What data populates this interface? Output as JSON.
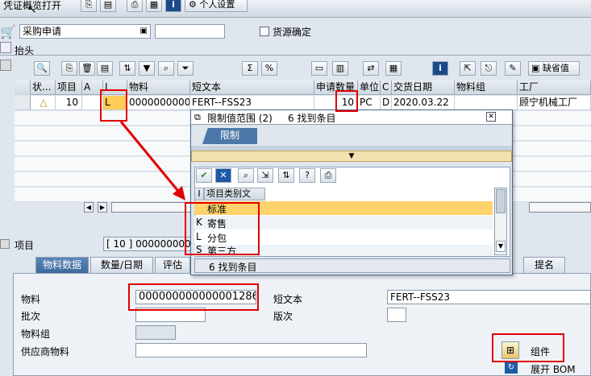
{
  "toolbar": {
    "doc_overview": "凭证概览打开",
    "personal_settings": "个人设置"
  },
  "header": {
    "doc_type": "采购申请",
    "source_assign_label": "货源确定",
    "section_label": "抬头"
  },
  "item_toolbar": {
    "default_values": "缺省值"
  },
  "grid": {
    "headers": [
      "状...",
      "项目",
      "A",
      "I",
      "物料",
      "短文本",
      "申请数量",
      "单位",
      "C",
      "交货日期",
      "物料组",
      "工厂"
    ],
    "row": {
      "status": "△",
      "item": "10",
      "a": "",
      "i": "L",
      "material": "000000000000",
      "short_text": "FERT--FSS23",
      "qty": "10",
      "unit": "PC",
      "c": "D",
      "date": "2020.03.22",
      "mat_group": "",
      "plant": "顾宁机械工厂"
    }
  },
  "item_detail": {
    "label": "项目",
    "value": "[ 10 ] 000000000000"
  },
  "tabs": [
    "物料数据",
    "数量/日期",
    "评估",
    "提名"
  ],
  "form": {
    "material_label": "物料",
    "material_value": "000000000000001286",
    "short_text_label": "短文本",
    "short_text_value": "FERT--FSS23",
    "batch_label": "批次",
    "revision_label": "版次",
    "mat_group_label": "物料组",
    "vendor_material_label": "供应商物料",
    "components_label": "组件",
    "explode_bom_label": "展开 BOM"
  },
  "popup": {
    "title": "限制值范围 (2)",
    "count_text": "6 找到条目",
    "restriction_tab": "限制",
    "col_i": "I",
    "col_desc": "项目类别文",
    "rows": [
      {
        "code": "",
        "text": "标准"
      },
      {
        "code": "K",
        "text": "寄售"
      },
      {
        "code": "L",
        "text": "分包"
      },
      {
        "code": "S",
        "text": "第三方"
      }
    ],
    "status": "6 找到条目"
  }
}
